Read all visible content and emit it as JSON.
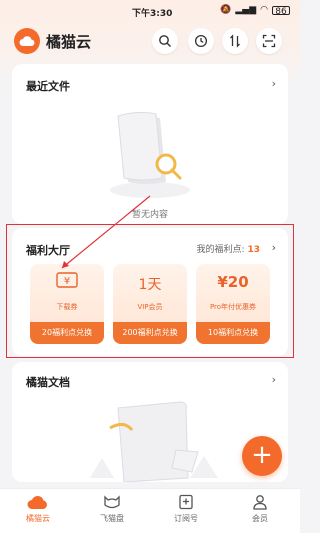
{
  "status_bar": {
    "time": "下午3:30",
    "battery": "86"
  },
  "header": {
    "title": "橘猫云"
  },
  "recent_files": {
    "title": "最近文件",
    "empty_text": "暂无内容"
  },
  "benefits": {
    "title": "福利大厅",
    "points_label": "我的福利点:",
    "points_value": "13",
    "coupons": [
      {
        "main": "¥",
        "sub": "下载券",
        "button": "20福利点兑换"
      },
      {
        "main": "1天",
        "sub": "VIP会员",
        "button": "200福利点兑换"
      },
      {
        "main": "¥20",
        "sub": "Pro年付优惠券",
        "button": "10福利点兑换"
      }
    ]
  },
  "docs": {
    "title": "橘猫文档"
  },
  "fab": {
    "label": "+"
  },
  "tabs": [
    {
      "label": "橘猫云",
      "icon": "cloud-icon",
      "active": true
    },
    {
      "label": "飞猫盘",
      "icon": "cat-icon",
      "active": false
    },
    {
      "label": "订阅号",
      "icon": "subscribe-icon",
      "active": false
    },
    {
      "label": "会员",
      "icon": "member-icon",
      "active": false
    }
  ],
  "colors": {
    "accent": "#f36a2b",
    "highlight": "#e0323a"
  }
}
